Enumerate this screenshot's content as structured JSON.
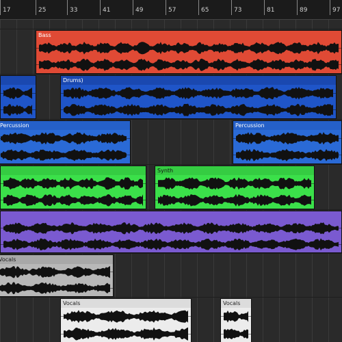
{
  "ruler": {
    "bars": [
      "17",
      "25",
      "33",
      "41",
      "49",
      "57",
      "65",
      "73",
      "81",
      "89",
      "97"
    ]
  },
  "colors": {
    "background": "#2a2a2a",
    "ruler": "#1b1b1b",
    "red": "#e04a35",
    "blue": "#1f55c8",
    "blue_lane3": "#2a6ad6",
    "green": "#3be04a",
    "purple": "#7a5ad0",
    "gray": "#b8b8b8",
    "white": "#ececec",
    "waveform": "#111111"
  },
  "tracks": [
    {
      "name": "bass-track",
      "clips": [
        {
          "label": "Bass",
          "color": "#e04a35",
          "header": "#e04a35",
          "label_color": "#ffffff"
        }
      ]
    },
    {
      "name": "drums-track",
      "clips": [
        {
          "label": "",
          "color": "#1f55c8",
          "header": "#1a48b0",
          "label_color": "#ffffff"
        },
        {
          "label": "Drums)",
          "color": "#1f55c8",
          "header": "#1a48b0",
          "label_color": "#ffffff"
        }
      ]
    },
    {
      "name": "percussion-track",
      "clips": [
        {
          "label": "Percussion",
          "color": "#2a6ad6",
          "header": "#2560c8",
          "label_color": "#ffffff"
        },
        {
          "label": "Percussion",
          "color": "#2a6ad6",
          "header": "#2560c8",
          "label_color": "#ffffff"
        }
      ]
    },
    {
      "name": "synth-track",
      "clips": [
        {
          "label": "",
          "color": "#3be04a",
          "header": "#35cc42",
          "label_color": "#111111"
        },
        {
          "label": "Synth",
          "color": "#3be04a",
          "header": "#35cc42",
          "label_color": "#111111"
        }
      ]
    },
    {
      "name": "pad-track",
      "clips": [
        {
          "label": "",
          "color": "#7a5ad0",
          "header": "#7a5ad0",
          "label_color": "#ffffff"
        }
      ]
    },
    {
      "name": "vocals-track-1",
      "clips": [
        {
          "label": "Vocals",
          "color": "#b8b8b8",
          "header": "#a8a8a8",
          "label_color": "#222222"
        }
      ]
    },
    {
      "name": "vocals-track-2",
      "clips": [
        {
          "label": "Vocals",
          "color": "#ececec",
          "header": "#dcdcdc",
          "label_color": "#222222"
        },
        {
          "label": "Vocals",
          "color": "#ececec",
          "header": "#dcdcdc",
          "label_color": "#222222"
        }
      ]
    }
  ]
}
